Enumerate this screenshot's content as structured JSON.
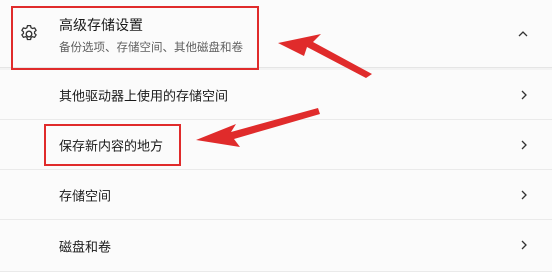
{
  "header": {
    "icon": "gear-icon",
    "title": "高级存储设置",
    "subtitle": "备份选项、存储空间、其他磁盘和卷",
    "expand_icon": "chevron-up-icon"
  },
  "items": [
    {
      "label": "其他驱动器上使用的存储空间",
      "icon": "chevron-right-icon"
    },
    {
      "label": "保存新内容的地方",
      "icon": "chevron-right-icon"
    },
    {
      "label": "存储空间",
      "icon": "chevron-right-icon"
    },
    {
      "label": "磁盘和卷",
      "icon": "chevron-right-icon"
    }
  ],
  "annotation_color": "#e02b2b"
}
